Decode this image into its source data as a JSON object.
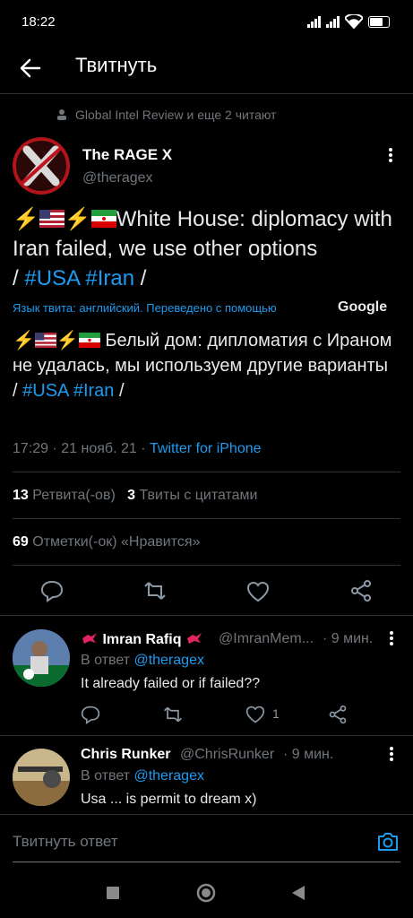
{
  "status": {
    "time": "18:22"
  },
  "header": {
    "title": "Твитнуть"
  },
  "readers": {
    "text": "Global Intel Review и еще 2 читают"
  },
  "tweet": {
    "author": "The RAGE X",
    "handle": "@theragex",
    "text_en": "White House: diplomacy with Iran failed, we use other options",
    "slash1": "/",
    "hashtag1": "#USA",
    "hashtag2": "#Iran",
    "slash2": "/",
    "translation_label": "Язык твита: английский. Переведено с помощью",
    "translation_provider": "Google",
    "text_ru": "Белый дом: дипломатия с Ираном не удалась, мы используем другие варианты",
    "time": "17:29",
    "date": "21 нояб. 21",
    "source": "Twitter for iPhone",
    "sep": "·",
    "retweets_count": "13",
    "retweets_label": "Ретвита(-ов)",
    "quotes_count": "3",
    "quotes_label": "Твиты с цитатами",
    "likes_count": "69",
    "likes_label": "Отметки(-ок) «Нравится»"
  },
  "replies": [
    {
      "name": "Imran Rafiq",
      "handle": "@ImranMem...",
      "time": "· 9 мин.",
      "in_reply_label": "В ответ",
      "in_reply_handle": "@theragex",
      "text": "It already failed or if failed??",
      "likes": "1"
    },
    {
      "name": "Chris Runker",
      "handle": "@ChrisRunker",
      "time": "· 9 мин.",
      "in_reply_label": "В ответ",
      "in_reply_handle": "@theragex",
      "text": "Usa ... is permit to dream x)"
    }
  ],
  "composer": {
    "placeholder": "Твитнуть ответ"
  },
  "colors": {
    "accent": "#1d9bf0",
    "background": "#000000",
    "muted": "#71767b"
  }
}
